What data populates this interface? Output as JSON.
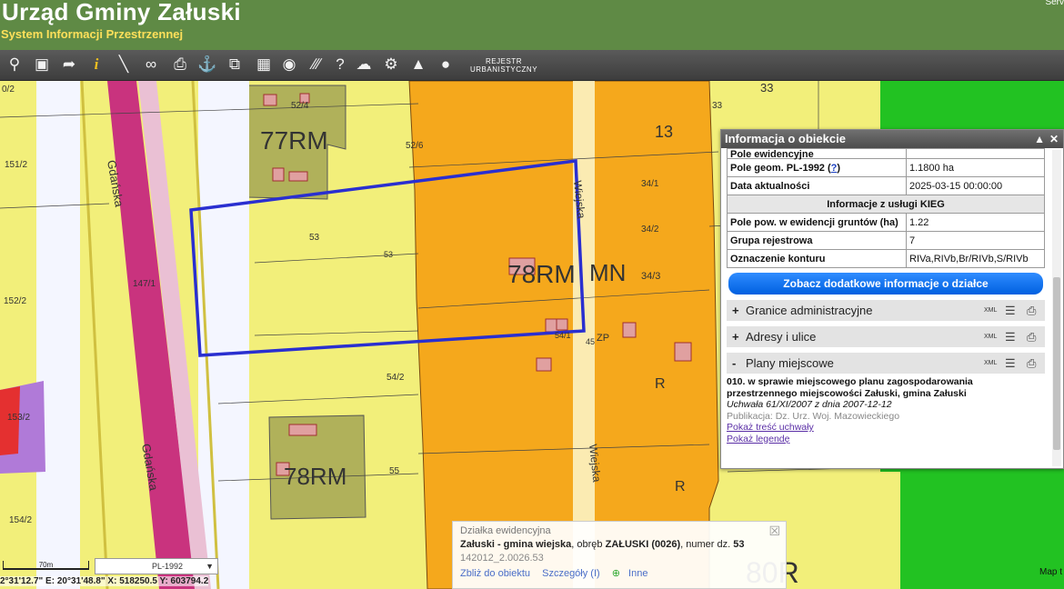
{
  "header": {
    "title": "Urząd Gminy Załuski",
    "subtitle": "System Informacji Przestrzennej",
    "corner": "Serv"
  },
  "toolbar": {
    "registry_label": "REJESTR URBANISTYCZNY",
    "icons": [
      "zoom-icon",
      "zoom-extent-icon",
      "pointer-icon",
      "info-icon",
      "measure-icon",
      "link-icon",
      "print-icon",
      "pin-icon",
      "copy-icon",
      "layout-icon",
      "comment-icon",
      "hatch-icon",
      "help-icon",
      "cloud-download-icon",
      "settings-icon",
      "terrain-icon",
      "chat-icon"
    ]
  },
  "map": {
    "labels": {
      "l1": "0/2",
      "l2": "151/2",
      "l3": "152/2",
      "l4": "153/2",
      "l5": "154/2",
      "l6": "147/1",
      "l7": "52/4",
      "l8": "52/6",
      "l9": "53",
      "l10": "53",
      "l11": "54/2",
      "l12": "55",
      "l13": "33",
      "l14": "13",
      "l15": "34/1",
      "l16": "34/2",
      "l17": "34/3",
      "l18": "54/1",
      "l19": "45",
      "l20": "33",
      "zone1": "77RM",
      "zone2": "78RM",
      "zone3": "MN",
      "zone4": "78RM",
      "zone5": "80R",
      "zone6": "R",
      "zone7": "R",
      "zone8": "ZP",
      "street1": "Gdańska",
      "street2": "Gdańska",
      "street3": "Wiejska",
      "street4": "Wiejska"
    }
  },
  "info_panel": {
    "title": "Informacja o obiekcie",
    "rows_top": [
      {
        "key": "Pole ewidencyjne",
        "value": ""
      },
      {
        "key": "Pole geom. PL-1992 (?)",
        "value": "1.1800 ha"
      },
      {
        "key": "Data aktualności",
        "value": "2025-03-15 00:00:00"
      }
    ],
    "section_kieg": "Informacje z usługi KIEG",
    "rows_kieg": [
      {
        "key": "Pole pow. w ewidencji gruntów (ha)",
        "value": "1.22"
      },
      {
        "key": "Grupa rejestrowa",
        "value": "7"
      },
      {
        "key": "Oznaczenie konturu",
        "value": "RIVa,RIVb,Br/RIVb,S/RIVb"
      }
    ],
    "more_button": "Zobacz dodatkowe informacje o działce",
    "sections": [
      {
        "sign": "+",
        "title": "Granice administracyjne",
        "xml": "XML"
      },
      {
        "sign": "+",
        "title": "Adresy i ulice",
        "xml": "XML"
      },
      {
        "sign": "-",
        "title": "Plany miejscowe",
        "xml": "XML"
      }
    ],
    "plan": {
      "title": "010. w sprawie miejscowego planu zagospodarowania przestrzennego miejscowości Załuski, gmina Załuski",
      "resolution": "Uchwała 61/XI/2007 z dnia 2007-12-12",
      "publication": "Publikacja: Dz. Urz. Woj. Mazowieckiego",
      "link_text": "Pokaż treść uchwały",
      "link_legend": "Pokaż legendę"
    }
  },
  "popup": {
    "title": "Działka ewidencyjna",
    "line_bold1": "Załuski - gmina wiejska",
    "line_mid": ", obręb ",
    "line_bold2": "ZAŁUSKI (0026)",
    "line_end": ", numer dz.",
    "line_num": "53",
    "id": "142012_2.0026.53",
    "link_zoom": "Zbliż do obiektu",
    "link_details": "Szczegóły (I)",
    "link_more": "Inne"
  },
  "status": {
    "coords": "2°31'12.7\"  E: 20°31'48.8\"  X: 518250.5   Y: 603794.2",
    "scale": "70m",
    "projection": "PL-1992",
    "map_credit": "Map t"
  },
  "colors": {
    "header": "#5f8a45",
    "zone_rm": "#b0b15a",
    "zone_mn": "#f5a81c",
    "zone_r": "#f2ef7a",
    "zone_green": "#22c222",
    "road_pink": "#c9337e",
    "parcel_outline": "#2a2fd0"
  }
}
